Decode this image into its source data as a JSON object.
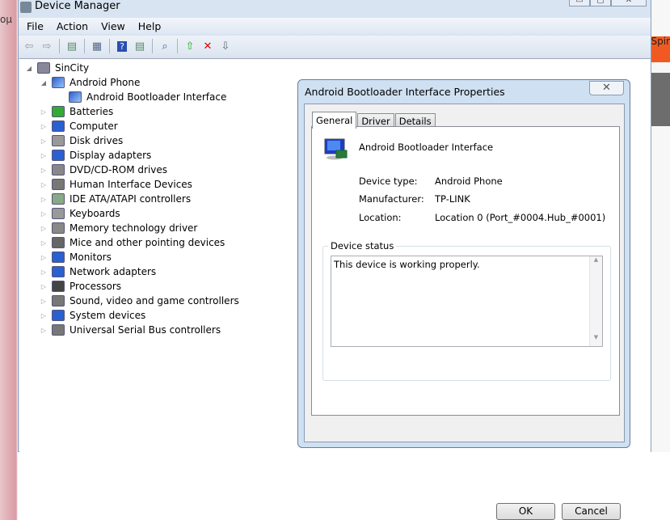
{
  "background": {
    "left_text": "ομ",
    "right_text": "Spir"
  },
  "window": {
    "title": "Device Manager"
  },
  "menu": [
    "File",
    "Action",
    "View",
    "Help"
  ],
  "toolbar": [
    "back-icon",
    "forward-icon",
    "show-hide-console-tree-icon",
    "properties-icon",
    "help-icon",
    "action-pane-icon",
    "scan-hardware-icon",
    "update-driver-icon",
    "uninstall-icon",
    "disable-icon"
  ],
  "tree": {
    "root": "SinCity",
    "expanded": {
      "label": "Android Phone",
      "children": [
        "Android Bootloader Interface"
      ]
    },
    "categories": [
      "Batteries",
      "Computer",
      "Disk drives",
      "Display adapters",
      "DVD/CD-ROM drives",
      "Human Interface Devices",
      "IDE ATA/ATAPI controllers",
      "Keyboards",
      "Memory technology driver",
      "Mice and other pointing devices",
      "Monitors",
      "Network adapters",
      "Processors",
      "Sound, video and game controllers",
      "System devices",
      "Universal Serial Bus controllers"
    ]
  },
  "dialog": {
    "title": "Android Bootloader Interface Properties",
    "close": "✕",
    "tabs": [
      "General",
      "Driver",
      "Details"
    ],
    "device_name": "Android Bootloader Interface",
    "fields": [
      {
        "label": "Device type:",
        "value": "Android Phone"
      },
      {
        "label": "Manufacturer:",
        "value": "TP-LINK"
      },
      {
        "label": "Location:",
        "value": "Location 0 (Port_#0004.Hub_#0001)"
      }
    ],
    "status_group": "Device status",
    "status_text": "This device is working properly.",
    "ok": "OK",
    "cancel": "Cancel"
  }
}
